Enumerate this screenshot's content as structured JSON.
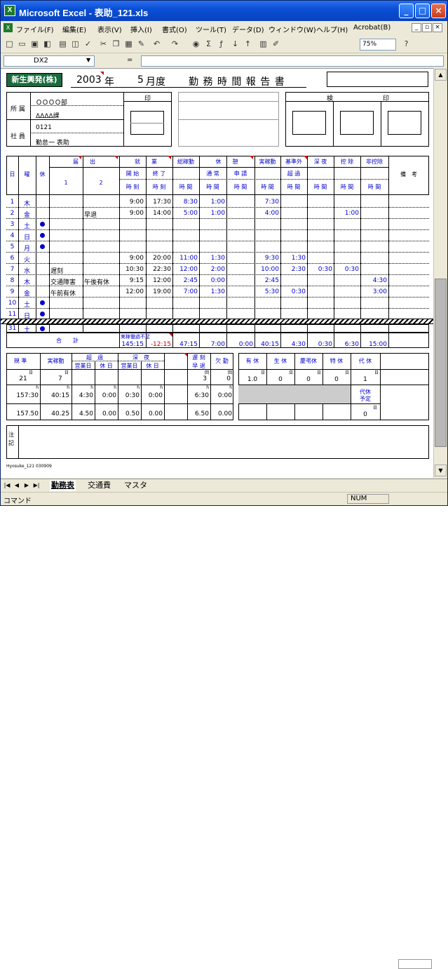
{
  "window": {
    "title": "Microsoft Excel - 表助_121.xls"
  },
  "menu": [
    "ファイル(F)",
    "編集(E)",
    "表示(V)",
    "挿入(I)",
    "書式(O)",
    "ツール(T)",
    "データ(D)",
    "ウィンドウ(W)",
    "ヘルプ(H)",
    "Acrobat(B)"
  ],
  "toolbar": {
    "zoom": "75%"
  },
  "formula": {
    "namebox": "DX2",
    "eq": "="
  },
  "sheet_header": {
    "company": "新生興発(株)",
    "year": "2003",
    "year_suffix": "年",
    "month": "5",
    "month_suffix": "月度",
    "title": "勤 務 時 間 報 告 書",
    "seal_label": "印",
    "check_label": "検",
    "seal_label2": "印",
    "dept_label": "所 属",
    "dept1": "ＯＯＯＯ部",
    "dept2": "ΔΔΔΔ課",
    "emp_label": "社 員",
    "emp_no": "0121",
    "emp_name": "勤怠一 表助"
  },
  "columns": {
    "day": "日",
    "dow": "曜",
    "holiday": "休",
    "todoke": "届　　出",
    "todoke1": "1",
    "todoke2": "2",
    "shugyo": "就　　業",
    "start": "開 始",
    "end": "終 了",
    "jikoku": "時 刻",
    "total": "総稼動",
    "kyukei": "休　　憩",
    "tsujo": "通 常",
    "shinsei": "申 請",
    "jitsu": "実稼動",
    "kijungai": "基準外",
    "choka": "超 過",
    "shinya": "深 夜",
    "kojo": "控 除",
    "hikojo": "非控除",
    "biko": "備　考",
    "jikan": "時 間"
  },
  "rows": [
    {
      "day": "1",
      "dow": "木",
      "hol": false,
      "t1": "",
      "t2": "",
      "start": "9:00",
      "end": "17:30",
      "total": "8:30",
      "tsujo": "1:00",
      "shinsei": "",
      "jitsu": "7:30",
      "choka": "",
      "shinya": "",
      "kojo": "",
      "hikojo": ""
    },
    {
      "day": "2",
      "dow": "金",
      "hol": false,
      "t1": "",
      "t2": "早退",
      "start": "9:00",
      "end": "14:00",
      "total": "5:00",
      "tsujo": "1:00",
      "shinsei": "",
      "jitsu": "4:00",
      "choka": "",
      "shinya": "",
      "kojo": "1:00",
      "hikojo": ""
    },
    {
      "day": "3",
      "dow": "土",
      "hol": true,
      "t1": "",
      "t2": "",
      "start": "",
      "end": "",
      "total": "",
      "tsujo": "",
      "shinsei": "",
      "jitsu": "",
      "choka": "",
      "shinya": "",
      "kojo": "",
      "hikojo": ""
    },
    {
      "day": "4",
      "dow": "日",
      "hol": true,
      "t1": "",
      "t2": "",
      "start": "",
      "end": "",
      "total": "",
      "tsujo": "",
      "shinsei": "",
      "jitsu": "",
      "choka": "",
      "shinya": "",
      "kojo": "",
      "hikojo": ""
    },
    {
      "day": "5",
      "dow": "月",
      "hol": true,
      "t1": "",
      "t2": "",
      "start": "",
      "end": "",
      "total": "",
      "tsujo": "",
      "shinsei": "",
      "jitsu": "",
      "choka": "",
      "shinya": "",
      "kojo": "",
      "hikojo": ""
    },
    {
      "day": "6",
      "dow": "火",
      "hol": false,
      "t1": "",
      "t2": "",
      "start": "9:00",
      "end": "20:00",
      "total": "11:00",
      "tsujo": "1:30",
      "shinsei": "",
      "jitsu": "9:30",
      "choka": "1:30",
      "shinya": "",
      "kojo": "",
      "hikojo": ""
    },
    {
      "day": "7",
      "dow": "水",
      "hol": false,
      "t1": "遅刻",
      "t2": "",
      "start": "10:30",
      "end": "22:30",
      "total": "12:00",
      "tsujo": "2:00",
      "shinsei": "",
      "jitsu": "10:00",
      "choka": "2:30",
      "shinya": "0:30",
      "kojo": "0:30",
      "hikojo": ""
    },
    {
      "day": "8",
      "dow": "木",
      "hol": false,
      "t1": "交通障害",
      "t2": "午後有休",
      "start": "9:15",
      "end": "12:00",
      "total": "2:45",
      "tsujo": "0:00",
      "shinsei": "",
      "jitsu": "2:45",
      "choka": "",
      "shinya": "",
      "kojo": "",
      "hikojo": "4:30"
    },
    {
      "day": "9",
      "dow": "金",
      "hol": false,
      "t1": "午前有休",
      "t2": "",
      "start": "12:00",
      "end": "19:00",
      "total": "7:00",
      "tsujo": "1:30",
      "shinsei": "",
      "jitsu": "5:30",
      "choka": "0:30",
      "shinya": "",
      "kojo": "",
      "hikojo": "3:00"
    },
    {
      "day": "10",
      "dow": "土",
      "hol": true,
      "t1": "",
      "t2": "",
      "start": "",
      "end": "",
      "total": "",
      "tsujo": "",
      "shinsei": "",
      "jitsu": "",
      "choka": "",
      "shinya": "",
      "kojo": "",
      "hikojo": ""
    },
    {
      "day": "11",
      "dow": "日",
      "hol": true,
      "t1": "",
      "t2": "",
      "start": "",
      "end": "",
      "total": "",
      "tsujo": "",
      "shinsei": "",
      "jitsu": "",
      "choka": "",
      "shinya": "",
      "kojo": "",
      "hikojo": ""
    }
  ],
  "row31": {
    "day": "31",
    "dow": "土",
    "hol": true
  },
  "totals": {
    "label": "合　　計",
    "actual_label": "実稼働過不足",
    "actual": "145:15",
    "diff": "-12:15",
    "total": "47:15",
    "tsujo": "7:00",
    "shinsei": "0:00",
    "jitsu": "40:15",
    "choka": "4:30",
    "shinya": "0:30",
    "kojo": "6:30",
    "hikojo": "15:00"
  },
  "summary": {
    "kitei": "規 準",
    "jitsu": "実稼動",
    "choka": "超　過",
    "eigyo": "営業日",
    "kyujitsu": "休 日",
    "shinya": "深　夜",
    "chikoku": "遅 刻",
    "sotai": "早 退",
    "kekkin": "欠 勤",
    "yukyu": "有 休",
    "seikyu": "生 休",
    "keicho": "慶弔休",
    "tokkyu": "特 休",
    "daikyu": "代 休",
    "unit_day": "日",
    "unit_h": "h",
    "unit_kai": "回",
    "days": "21",
    "jitsu_days": "7",
    "chikoku_cnt": "3",
    "kekkin_cnt": "0",
    "yukyu_n": "1.0",
    "seikyu_n": "0",
    "keicho_n": "0",
    "tokkyu_n": "0",
    "daikyu_n": "1",
    "kitei_h": "157:30",
    "jitsu_h": "40:15",
    "choka_e": "4:30",
    "choka_k": "0:00",
    "shinya_e": "0:30",
    "shinya_k": "0:00",
    "chikoku_h": "6:30",
    "kekkin_h": "0:00",
    "daikyu_yotei": "代休\n予定",
    "daikyu_yotei_n": "0",
    "kitei_d": "157.50",
    "jitsu_d": "40.25",
    "choka_ed": "4.50",
    "choka_kd": "0.00",
    "shinya_ed": "0.50",
    "shinya_kd": "0.00",
    "chikoku_d": "6.50",
    "kekkin_d": "0.00"
  },
  "remarks": {
    "label": "注記"
  },
  "footer_code": "Hyosuke_121 030909",
  "tabs": [
    "勤務表",
    "交通費",
    "マスタ"
  ],
  "status": {
    "left": "コマンド",
    "num": "NUM"
  }
}
